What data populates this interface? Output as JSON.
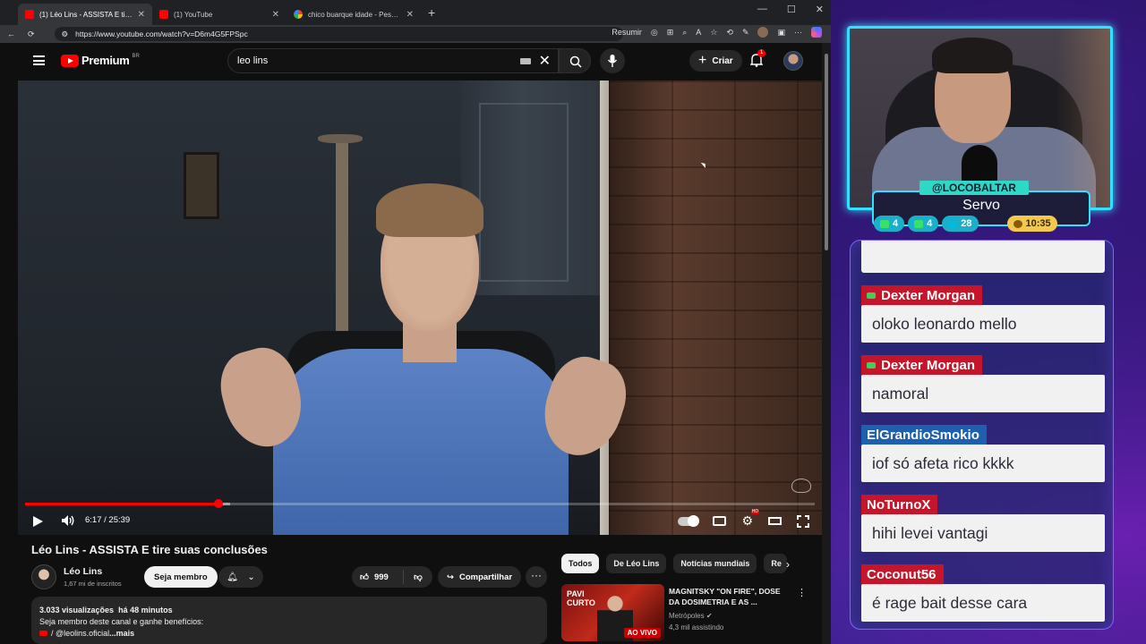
{
  "browser": {
    "tabs": [
      {
        "title": "(1) Léo Lins - ASSISTA E tire suas c",
        "favicon": "youtube-icon",
        "active": true
      },
      {
        "title": "(1) YouTube",
        "favicon": "youtube-icon",
        "active": false
      },
      {
        "title": "chico buarque idade - Pesquisa G",
        "favicon": "google-icon",
        "active": false
      }
    ],
    "url": "https://www.youtube.com/watch?v=D6m4G5FPSpc",
    "resumir_label": "Resumir"
  },
  "youtube": {
    "logo_text": "Premium",
    "logo_country": "BR",
    "search_value": "leo lins",
    "create_label": "Criar",
    "notification_count": "1",
    "player": {
      "current_time": "6:17",
      "duration": "25:39",
      "played_fraction": 0.245,
      "buffered_fraction": 0.26
    },
    "video_title": "Léo Lins - ASSISTA E tire suas conclusões",
    "channel": {
      "name": "Léo Lins",
      "subscribers": "1,67 mi de inscritos",
      "member_label": "Seja membro"
    },
    "likes": "999",
    "share_label": "Compartilhar",
    "description": {
      "views": "3.033 visualizações",
      "age": "há 48 minutos",
      "line1": "Seja membro deste canal e ganhe benefícios:",
      "line2": "/ @leolins.oficial",
      "more": "...mais"
    },
    "chips": [
      "Todos",
      "De Léo Lins",
      "Notícias mundiais",
      "Re"
    ],
    "recommendation": {
      "thumb_text": "PAVI CURTO",
      "live_label": "AO VIVO",
      "title": "MAGNITSKY \"ON FIRE\", DOSE DA DOSIMETRIA E AS ...",
      "channel": "Metrópoles",
      "watching": "4,3 mil assistindo"
    }
  },
  "stream": {
    "handle": "@LOCOBALTAR",
    "role": "Servo",
    "stats": {
      "chat": "4",
      "yt": "4",
      "coins": "28",
      "time": "10:35"
    },
    "colors": {
      "cam_border": "#33e0ff",
      "handle_bg": "#2fd7c6",
      "time_badge": "#f2c94c"
    }
  },
  "chat": {
    "messages": [
      {
        "user": "Dexter Morgan",
        "user_color": "#c4152b",
        "has_badge": true,
        "text": "oloko leonardo mello"
      },
      {
        "user": "Dexter Morgan",
        "user_color": "#c4152b",
        "has_badge": true,
        "text": "namoral"
      },
      {
        "user": "ElGrandioSmokio",
        "user_color": "#1f5fb0",
        "has_badge": false,
        "text": "iof só afeta rico kkkk"
      },
      {
        "user": "NoTurnoX",
        "user_color": "#c4152b",
        "has_badge": false,
        "text": "hihi levei vantagi"
      },
      {
        "user": "Coconut56",
        "user_color": "#c4152b",
        "has_badge": false,
        "text": "é rage bait desse cara"
      }
    ]
  }
}
